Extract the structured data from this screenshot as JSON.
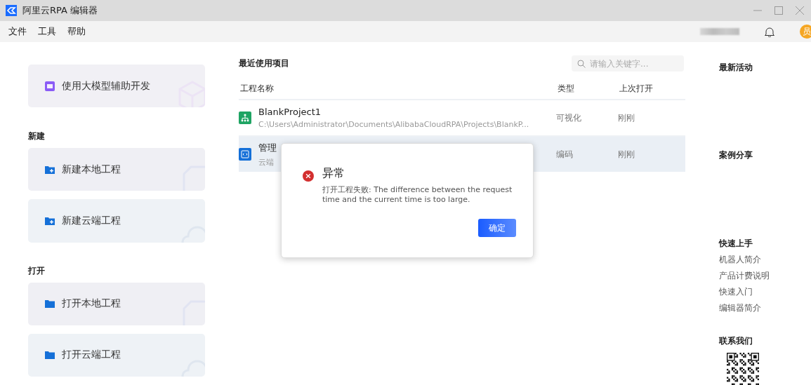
{
  "window": {
    "title": "阿里云RPA 编辑器"
  },
  "menu": [
    "文件",
    "工具",
    "帮助"
  ],
  "user": {
    "avatar": "员"
  },
  "quick_card": {
    "label": "使用大模型辅助开发",
    "kind": "ai"
  },
  "sections": [
    {
      "title": "新建",
      "cards": [
        {
          "label": "新建本地工程",
          "kind": "new-local"
        },
        {
          "label": "新建云端工程",
          "kind": "new-cloud"
        }
      ]
    },
    {
      "title": "打开",
      "cards": [
        {
          "label": "打开本地工程",
          "kind": "open-local"
        },
        {
          "label": "打开云端工程",
          "kind": "open-cloud"
        }
      ]
    }
  ],
  "recent": {
    "title": "最近使用项目",
    "search": {
      "placeholder": "请输入关键字..."
    },
    "columns": [
      "工程名称",
      "类型",
      "上次打开"
    ],
    "rows": [
      {
        "name": "BlankProject1",
        "path": "C:\\Users\\Administrator\\Documents\\AlibabaCloudRPA\\Projects\\BlankP...",
        "type": "可视化",
        "last_opened": "刚刚",
        "kind": "visual",
        "selected": false
      },
      {
        "name": "管理",
        "path": "云端",
        "type": "编码",
        "last_opened": "刚刚",
        "kind": "code",
        "selected": true
      }
    ]
  },
  "side": {
    "headings": [
      "最新活动",
      "案例分享"
    ],
    "quick_start": {
      "title": "快速上手",
      "links": [
        "机器人简介",
        "产品计费说明",
        "快速入门",
        "编辑器简介"
      ]
    },
    "contact": {
      "title": "联系我们"
    }
  },
  "dialog": {
    "title": "异常",
    "message": "打开工程失败: The difference between the request time and the current time is too large.",
    "button": "确定"
  }
}
